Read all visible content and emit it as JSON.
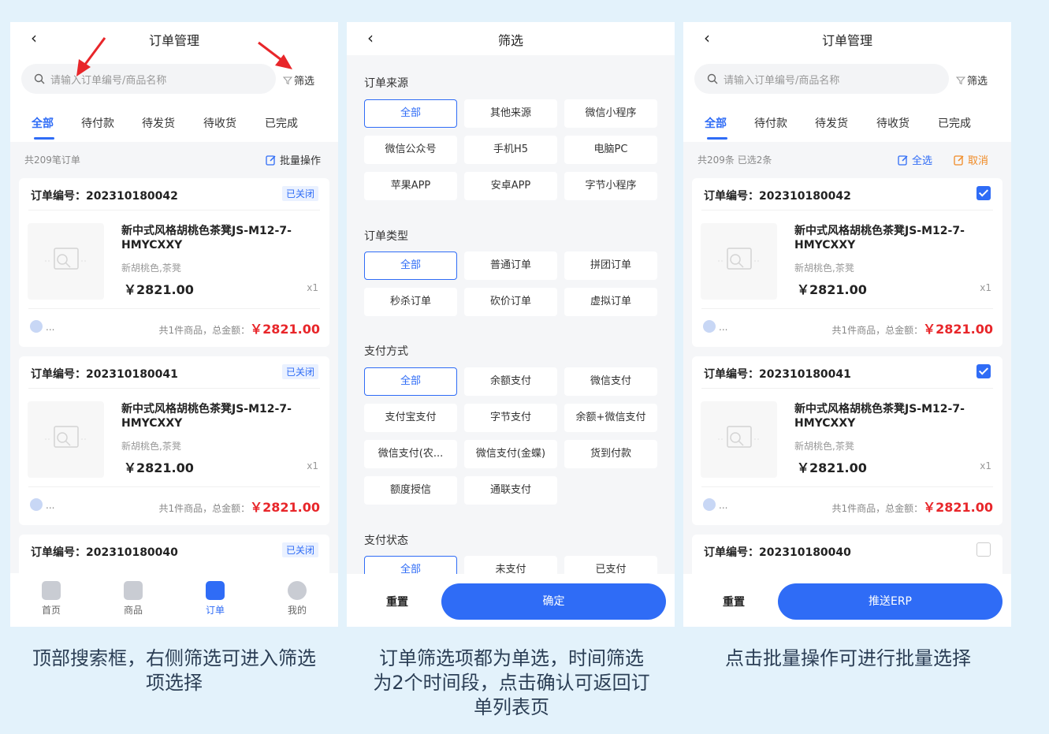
{
  "panel1": {
    "nav_title": "订单管理",
    "search_placeholder": "请输入订单编号/商品名称",
    "filter_label": "筛选",
    "tabs": [
      "全部",
      "待付款",
      "待发货",
      "待收货",
      "已完成"
    ],
    "count_text": "共209笔订单",
    "batch_label": "批量操作",
    "orders": [
      {
        "order_no": "订单编号：202310180042",
        "status": "已关闭",
        "product": "新中式风格胡桃色茶凳JS-M12-7-HMYCXXY",
        "spec": "新胡桃色,茶凳",
        "price": "￥2821.00",
        "qty": "x1",
        "shop": "...",
        "total_label": "共1件商品，总金额：",
        "total": "￥2821.00"
      },
      {
        "order_no": "订单编号：202310180041",
        "status": "已关闭",
        "product": "新中式风格胡桃色茶凳JS-M12-7-HMYCXXY",
        "spec": "新胡桃色,茶凳",
        "price": "￥2821.00",
        "qty": "x1",
        "shop": "...",
        "total_label": "共1件商品，总金额：",
        "total": "￥2821.00"
      },
      {
        "order_no": "订单编号：202310180040",
        "status": "已关闭"
      }
    ],
    "tabbar": [
      "首页",
      "商品",
      "订单",
      "我的"
    ]
  },
  "panel2": {
    "nav_title": "筛选",
    "sections": [
      {
        "title": "订单来源",
        "options": [
          "全部",
          "其他来源",
          "微信小程序",
          "微信公众号",
          "手机H5",
          "电脑PC",
          "苹果APP",
          "安卓APP",
          "字节小程序"
        ]
      },
      {
        "title": "订单类型",
        "options": [
          "全部",
          "普通订单",
          "拼团订单",
          "秒杀订单",
          "砍价订单",
          "虚拟订单"
        ]
      },
      {
        "title": "支付方式",
        "options": [
          "全部",
          "余额支付",
          "微信支付",
          "支付宝支付",
          "字节支付",
          "余额+微信支付",
          "微信支付(农...",
          "微信支付(金蝶)",
          "货到付款",
          "额度授信",
          "通联支付"
        ]
      },
      {
        "title": "支付状态",
        "options": [
          "全部",
          "未支付",
          "已支付"
        ]
      }
    ],
    "reset_label": "重置",
    "confirm_label": "确定"
  },
  "panel3": {
    "nav_title": "订单管理",
    "search_placeholder": "请输入订单编号/商品名称",
    "filter_label": "筛选",
    "tabs": [
      "全部",
      "待付款",
      "待发货",
      "待收货",
      "已完成"
    ],
    "count_prefix": "共209条",
    "count_selected": "已选2条",
    "select_all_label": "全选",
    "cancel_label": "取消",
    "orders": [
      {
        "order_no": "订单编号：202310180042",
        "checked": true,
        "product": "新中式风格胡桃色茶凳JS-M12-7-HMYCXXY",
        "spec": "新胡桃色,茶凳",
        "price": "￥2821.00",
        "qty": "x1",
        "shop": "...",
        "total_label": "共1件商品，总金额：",
        "total": "￥2821.00"
      },
      {
        "order_no": "订单编号：202310180041",
        "checked": true,
        "product": "新中式风格胡桃色茶凳JS-M12-7-HMYCXXY",
        "spec": "新胡桃色,茶凳",
        "price": "￥2821.00",
        "qty": "x1",
        "shop": "...",
        "total_label": "共1件商品，总金额：",
        "total": "￥2821.00"
      },
      {
        "order_no": "订单编号：202310180040",
        "checked": false
      }
    ],
    "reset_label": "重置",
    "push_label": "推送ERP"
  },
  "captions": [
    "顶部搜索框，右侧筛选可进入筛选项选择",
    "订单筛选项都为单选，时间筛选为2个时间段，点击确认可返回订单列表页",
    "点击批量操作可进行批量选择"
  ],
  "colors": {
    "accent": "#2f6cf6",
    "price_red": "#e8262a",
    "arrow_red": "#e8262a",
    "page_bg": "#e3f2fb"
  }
}
